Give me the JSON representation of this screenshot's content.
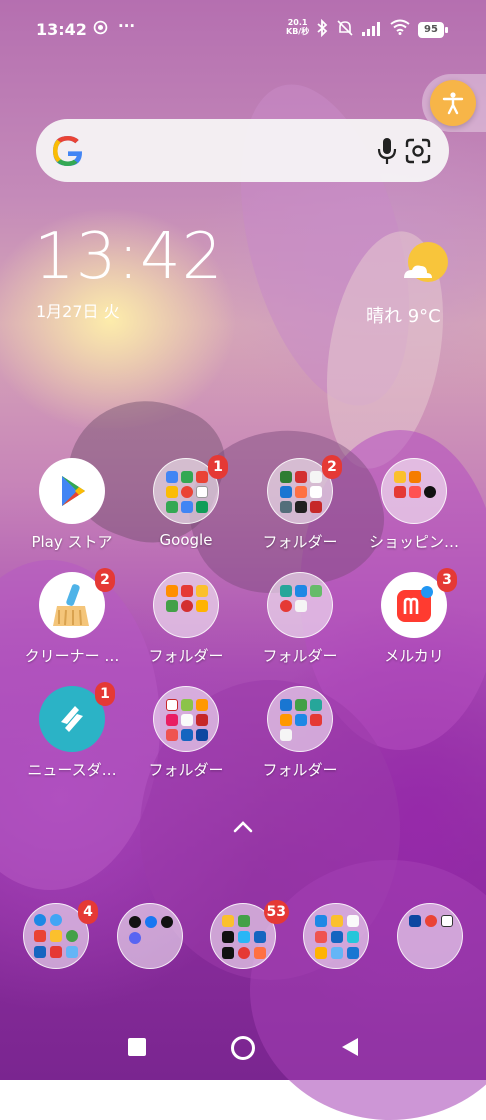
{
  "status_bar": {
    "time": "13:42",
    "net_speed_value": "20.1",
    "net_speed_unit": "KB/秒",
    "battery": "95",
    "more": "···"
  },
  "search": {
    "logo": "G"
  },
  "clock_widget": {
    "time": "13:42",
    "date": "1月27日 火",
    "weather": "晴れ 9°C"
  },
  "apps": [
    {
      "label": "Play ストア",
      "badge": ""
    },
    {
      "label": "Google",
      "badge": "1"
    },
    {
      "label": "フォルダー",
      "badge": "2"
    },
    {
      "label": "ショッピン…",
      "badge": ""
    },
    {
      "label": "クリーナー …",
      "badge": "2"
    },
    {
      "label": "フォルダー",
      "badge": ""
    },
    {
      "label": "フォルダー",
      "badge": ""
    },
    {
      "label": "メルカリ",
      "badge": "3"
    },
    {
      "label": "ニュースダ…",
      "badge": "1"
    },
    {
      "label": "フォルダー",
      "badge": ""
    },
    {
      "label": "フォルダー",
      "badge": ""
    }
  ],
  "dock": [
    {
      "badge": "4"
    },
    {
      "badge": ""
    },
    {
      "badge": "53"
    },
    {
      "badge": ""
    },
    {
      "badge": ""
    }
  ],
  "colors": {
    "badge": "#e53935",
    "accessibility": "#f7b548"
  }
}
